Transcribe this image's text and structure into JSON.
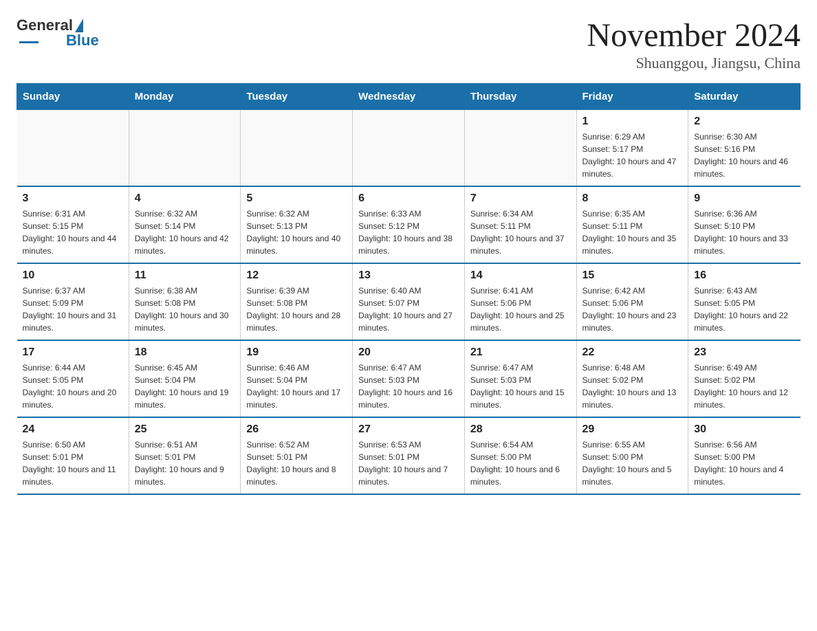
{
  "logo": {
    "general": "General",
    "blue": "Blue"
  },
  "header": {
    "title": "November 2024",
    "location": "Shuanggou, Jiangsu, China"
  },
  "days_of_week": [
    "Sunday",
    "Monday",
    "Tuesday",
    "Wednesday",
    "Thursday",
    "Friday",
    "Saturday"
  ],
  "weeks": [
    [
      {
        "day": "",
        "sunrise": "",
        "sunset": "",
        "daylight": ""
      },
      {
        "day": "",
        "sunrise": "",
        "sunset": "",
        "daylight": ""
      },
      {
        "day": "",
        "sunrise": "",
        "sunset": "",
        "daylight": ""
      },
      {
        "day": "",
        "sunrise": "",
        "sunset": "",
        "daylight": ""
      },
      {
        "day": "",
        "sunrise": "",
        "sunset": "",
        "daylight": ""
      },
      {
        "day": "1",
        "sunrise": "Sunrise: 6:29 AM",
        "sunset": "Sunset: 5:17 PM",
        "daylight": "Daylight: 10 hours and 47 minutes."
      },
      {
        "day": "2",
        "sunrise": "Sunrise: 6:30 AM",
        "sunset": "Sunset: 5:16 PM",
        "daylight": "Daylight: 10 hours and 46 minutes."
      }
    ],
    [
      {
        "day": "3",
        "sunrise": "Sunrise: 6:31 AM",
        "sunset": "Sunset: 5:15 PM",
        "daylight": "Daylight: 10 hours and 44 minutes."
      },
      {
        "day": "4",
        "sunrise": "Sunrise: 6:32 AM",
        "sunset": "Sunset: 5:14 PM",
        "daylight": "Daylight: 10 hours and 42 minutes."
      },
      {
        "day": "5",
        "sunrise": "Sunrise: 6:32 AM",
        "sunset": "Sunset: 5:13 PM",
        "daylight": "Daylight: 10 hours and 40 minutes."
      },
      {
        "day": "6",
        "sunrise": "Sunrise: 6:33 AM",
        "sunset": "Sunset: 5:12 PM",
        "daylight": "Daylight: 10 hours and 38 minutes."
      },
      {
        "day": "7",
        "sunrise": "Sunrise: 6:34 AM",
        "sunset": "Sunset: 5:11 PM",
        "daylight": "Daylight: 10 hours and 37 minutes."
      },
      {
        "day": "8",
        "sunrise": "Sunrise: 6:35 AM",
        "sunset": "Sunset: 5:11 PM",
        "daylight": "Daylight: 10 hours and 35 minutes."
      },
      {
        "day": "9",
        "sunrise": "Sunrise: 6:36 AM",
        "sunset": "Sunset: 5:10 PM",
        "daylight": "Daylight: 10 hours and 33 minutes."
      }
    ],
    [
      {
        "day": "10",
        "sunrise": "Sunrise: 6:37 AM",
        "sunset": "Sunset: 5:09 PM",
        "daylight": "Daylight: 10 hours and 31 minutes."
      },
      {
        "day": "11",
        "sunrise": "Sunrise: 6:38 AM",
        "sunset": "Sunset: 5:08 PM",
        "daylight": "Daylight: 10 hours and 30 minutes."
      },
      {
        "day": "12",
        "sunrise": "Sunrise: 6:39 AM",
        "sunset": "Sunset: 5:08 PM",
        "daylight": "Daylight: 10 hours and 28 minutes."
      },
      {
        "day": "13",
        "sunrise": "Sunrise: 6:40 AM",
        "sunset": "Sunset: 5:07 PM",
        "daylight": "Daylight: 10 hours and 27 minutes."
      },
      {
        "day": "14",
        "sunrise": "Sunrise: 6:41 AM",
        "sunset": "Sunset: 5:06 PM",
        "daylight": "Daylight: 10 hours and 25 minutes."
      },
      {
        "day": "15",
        "sunrise": "Sunrise: 6:42 AM",
        "sunset": "Sunset: 5:06 PM",
        "daylight": "Daylight: 10 hours and 23 minutes."
      },
      {
        "day": "16",
        "sunrise": "Sunrise: 6:43 AM",
        "sunset": "Sunset: 5:05 PM",
        "daylight": "Daylight: 10 hours and 22 minutes."
      }
    ],
    [
      {
        "day": "17",
        "sunrise": "Sunrise: 6:44 AM",
        "sunset": "Sunset: 5:05 PM",
        "daylight": "Daylight: 10 hours and 20 minutes."
      },
      {
        "day": "18",
        "sunrise": "Sunrise: 6:45 AM",
        "sunset": "Sunset: 5:04 PM",
        "daylight": "Daylight: 10 hours and 19 minutes."
      },
      {
        "day": "19",
        "sunrise": "Sunrise: 6:46 AM",
        "sunset": "Sunset: 5:04 PM",
        "daylight": "Daylight: 10 hours and 17 minutes."
      },
      {
        "day": "20",
        "sunrise": "Sunrise: 6:47 AM",
        "sunset": "Sunset: 5:03 PM",
        "daylight": "Daylight: 10 hours and 16 minutes."
      },
      {
        "day": "21",
        "sunrise": "Sunrise: 6:47 AM",
        "sunset": "Sunset: 5:03 PM",
        "daylight": "Daylight: 10 hours and 15 minutes."
      },
      {
        "day": "22",
        "sunrise": "Sunrise: 6:48 AM",
        "sunset": "Sunset: 5:02 PM",
        "daylight": "Daylight: 10 hours and 13 minutes."
      },
      {
        "day": "23",
        "sunrise": "Sunrise: 6:49 AM",
        "sunset": "Sunset: 5:02 PM",
        "daylight": "Daylight: 10 hours and 12 minutes."
      }
    ],
    [
      {
        "day": "24",
        "sunrise": "Sunrise: 6:50 AM",
        "sunset": "Sunset: 5:01 PM",
        "daylight": "Daylight: 10 hours and 11 minutes."
      },
      {
        "day": "25",
        "sunrise": "Sunrise: 6:51 AM",
        "sunset": "Sunset: 5:01 PM",
        "daylight": "Daylight: 10 hours and 9 minutes."
      },
      {
        "day": "26",
        "sunrise": "Sunrise: 6:52 AM",
        "sunset": "Sunset: 5:01 PM",
        "daylight": "Daylight: 10 hours and 8 minutes."
      },
      {
        "day": "27",
        "sunrise": "Sunrise: 6:53 AM",
        "sunset": "Sunset: 5:01 PM",
        "daylight": "Daylight: 10 hours and 7 minutes."
      },
      {
        "day": "28",
        "sunrise": "Sunrise: 6:54 AM",
        "sunset": "Sunset: 5:00 PM",
        "daylight": "Daylight: 10 hours and 6 minutes."
      },
      {
        "day": "29",
        "sunrise": "Sunrise: 6:55 AM",
        "sunset": "Sunset: 5:00 PM",
        "daylight": "Daylight: 10 hours and 5 minutes."
      },
      {
        "day": "30",
        "sunrise": "Sunrise: 6:56 AM",
        "sunset": "Sunset: 5:00 PM",
        "daylight": "Daylight: 10 hours and 4 minutes."
      }
    ]
  ]
}
